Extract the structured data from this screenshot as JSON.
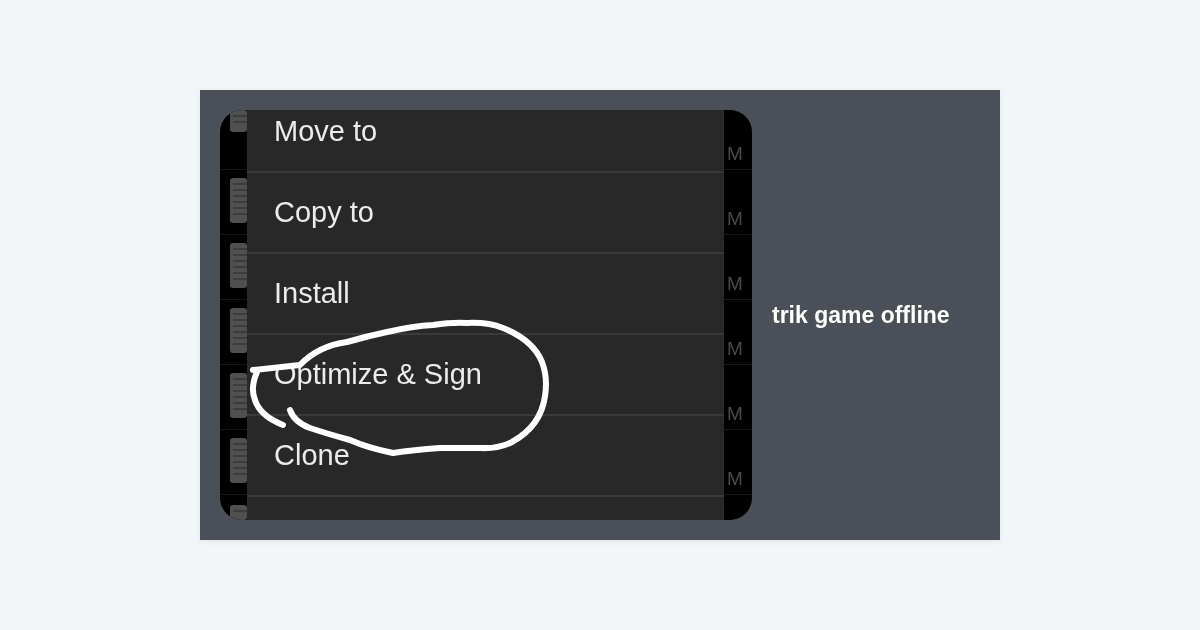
{
  "screenshot": {
    "background_rows": [
      {
        "trailing_text": "M"
      },
      {
        "trailing_text": "M"
      },
      {
        "trailing_text": "M"
      },
      {
        "trailing_text": "M"
      },
      {
        "trailing_text": "M"
      },
      {
        "trailing_text": "M"
      }
    ],
    "menu_items": [
      {
        "label": "Move to",
        "circled": false
      },
      {
        "label": "Copy to",
        "circled": false
      },
      {
        "label": "Install",
        "circled": false
      },
      {
        "label": "Optimize & Sign",
        "circled": true
      },
      {
        "label": "Clone",
        "circled": false
      }
    ]
  },
  "caption": "trik game offline"
}
